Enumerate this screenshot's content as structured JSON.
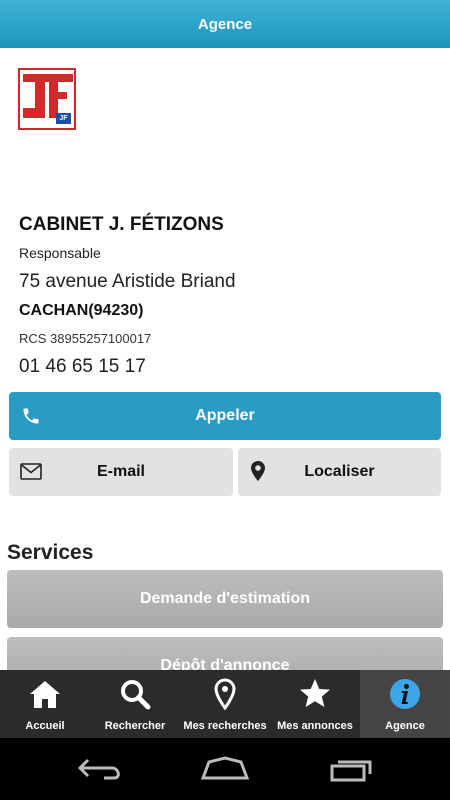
{
  "header": {
    "title": "Agence"
  },
  "agency": {
    "logo_text": "JF",
    "name": "CABINET J. FÉTIZONS",
    "role": "Responsable",
    "street": "75 avenue Aristide Briand",
    "city": "CACHAN(94230)",
    "rcs": "RCS 38955257100017",
    "phone": "01 46 65 15 17"
  },
  "actions": {
    "call": "Appeler",
    "email": "E-mail",
    "locate": "Localiser"
  },
  "services": {
    "title": "Services",
    "items": [
      "Demande d'estimation",
      "Dépôt d'annonce"
    ]
  },
  "tabs": [
    {
      "label": "Accueil",
      "icon": "home-icon"
    },
    {
      "label": "Rechercher",
      "icon": "search-icon"
    },
    {
      "label": "Mes recherches",
      "icon": "map-pin-icon"
    },
    {
      "label": "Mes annonces",
      "icon": "star-icon"
    },
    {
      "label": "Agence",
      "icon": "info-icon"
    }
  ],
  "active_tab": "Agence",
  "colors": {
    "accent": "#2a9bc5",
    "button_grey": "#e2e2e2",
    "service_grey": "#b3b3b3",
    "tabbar": "#2b2b2b"
  }
}
